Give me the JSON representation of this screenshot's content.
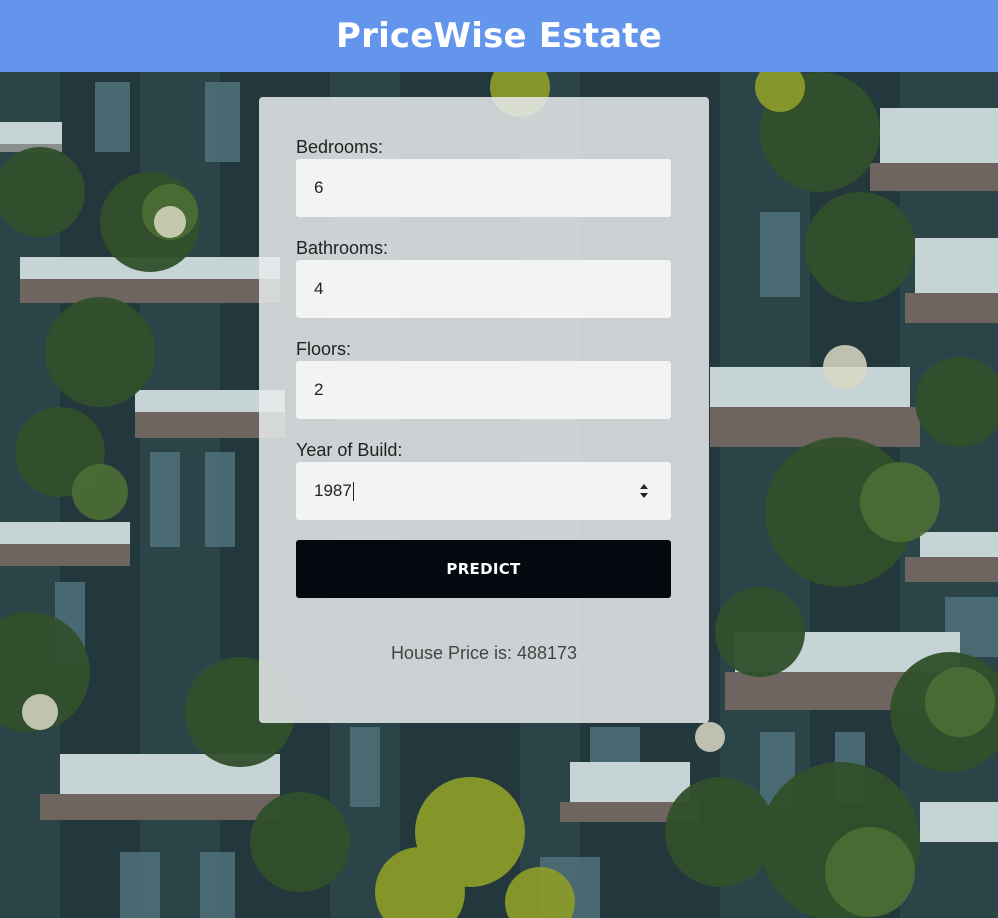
{
  "header": {
    "title": "PriceWise Estate"
  },
  "form": {
    "bedrooms": {
      "label": "Bedrooms:",
      "value": "6"
    },
    "bathrooms": {
      "label": "Bathrooms:",
      "value": "4"
    },
    "floors": {
      "label": "Floors:",
      "value": "2"
    },
    "year_of_build": {
      "label": "Year of Build:",
      "value": "1987"
    },
    "predict_label": "PREDICT"
  },
  "result": {
    "text": "House Price is: 488173"
  },
  "colors": {
    "header_bg": "#6495ed",
    "button_bg": "#040910",
    "card_bg": "#e8eaeb"
  },
  "icons": {
    "year_stepper": "up-down-spinner-icon"
  }
}
